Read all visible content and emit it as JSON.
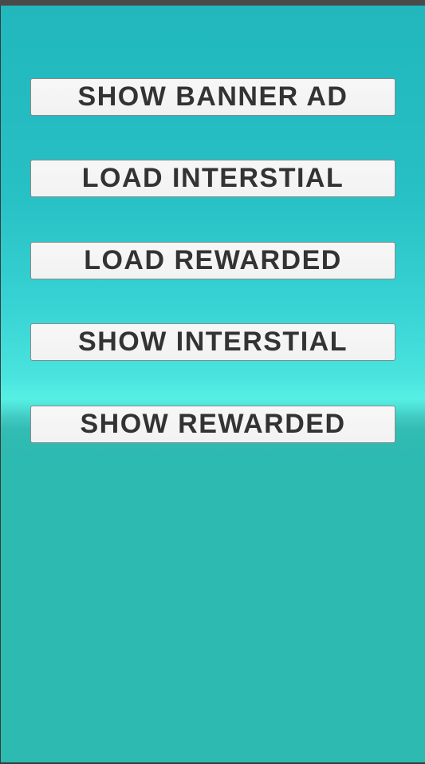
{
  "buttons": [
    {
      "label": "SHOW BANNER AD"
    },
    {
      "label": "LOAD INTERSTIAL"
    },
    {
      "label": "LOAD REWARDED"
    },
    {
      "label": "SHOW INTERSTIAL"
    },
    {
      "label": "SHOW REWARDED"
    }
  ],
  "colors": {
    "sky_top": "#21b7bd",
    "horizon": "#52ece2",
    "ground": "#2dbab1",
    "button_bg": "#f5f5f5",
    "button_text": "#333333",
    "button_border": "#8a8a8a"
  }
}
